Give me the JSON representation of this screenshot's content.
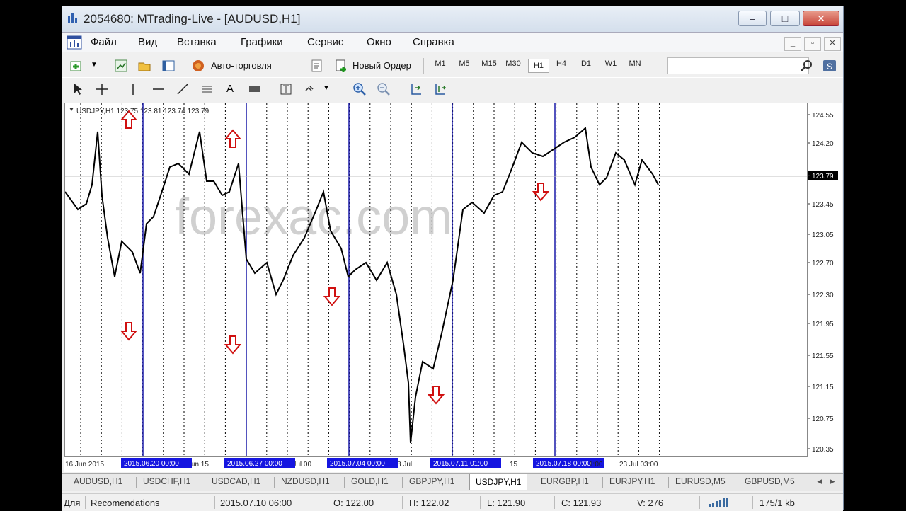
{
  "window": {
    "title": "2054680: MTrading-Live - [AUDUSD,H1]",
    "minimize": "–",
    "maximize": "□",
    "close": "✕"
  },
  "menu": [
    "Файл",
    "Вид",
    "Вставка",
    "Графики",
    "Сервис",
    "Окно",
    "Справка"
  ],
  "toolbar": {
    "autotrade_label": "Авто-торговля",
    "new_order_label": "Новый Ордер",
    "timeframes": [
      "M1",
      "M5",
      "M15",
      "M30",
      "H1",
      "H4",
      "D1",
      "W1",
      "MN"
    ],
    "active_timeframe": "H1",
    "search_value": ""
  },
  "drawing_toolbar": {
    "text_tool": "A"
  },
  "chart": {
    "header": "USDJPY,H1  123.75 123.81 123.74 123.79",
    "watermark": "forexac.com",
    "current_price": "123.79",
    "price_ticks": [
      "124.55",
      "124.20",
      "123.79",
      "123.45",
      "123.05",
      "122.70",
      "122.30",
      "121.95",
      "121.55",
      "121.15",
      "120.75",
      "120.35"
    ],
    "time_labels": [
      "16 Jun 2015",
      "23 Jun 15",
      "1 Jul 00",
      "8 Jul",
      "15",
      "23 Jul 03:00"
    ],
    "period_markers": [
      "2015.06.20 00:00",
      "2015.06.27 00:00",
      "2015.07.04 00:00",
      "2015.07.11 01:00",
      "2015.07.18 00:00"
    ],
    "marker_trailing_text": "1:00",
    "colors": {
      "candle": "#000000",
      "grid": "#000000",
      "period_line": "#1a1aa8",
      "marker_bg": "#1515e0",
      "arrow": "#d01010",
      "watermark": "#c8c8c8"
    },
    "arrows": [
      {
        "dir": "up",
        "x": "2015-06-18"
      },
      {
        "dir": "down",
        "x": "2015-06-18"
      },
      {
        "dir": "up",
        "x": "2015-06-25"
      },
      {
        "dir": "down",
        "x": "2015-06-25"
      },
      {
        "dir": "down",
        "x": "2015-07-02"
      },
      {
        "dir": "down",
        "x": "2015-07-09"
      },
      {
        "dir": "down",
        "x": "2015-07-16"
      }
    ]
  },
  "tabs": [
    "AUDUSD,H1",
    "USDCHF,H1",
    "USDCAD,H1",
    "NZDUSD,H1",
    "GOLD,H1",
    "GBPJPY,H1",
    "USDJPY,H1",
    "EURGBP,H1",
    "EURJPY,H1",
    "EURUSD,M5",
    "GBPUSD,M5"
  ],
  "active_tab": "USDJPY,H1",
  "status": {
    "help_hint": "Для",
    "profile": "Recomendations",
    "datetime": "2015.07.10 06:00",
    "open": "O: 122.00",
    "high": "H: 122.02",
    "low": "L: 121.90",
    "close": "C: 121.93",
    "volume": "V: 276",
    "traffic": "175/1 kb"
  }
}
